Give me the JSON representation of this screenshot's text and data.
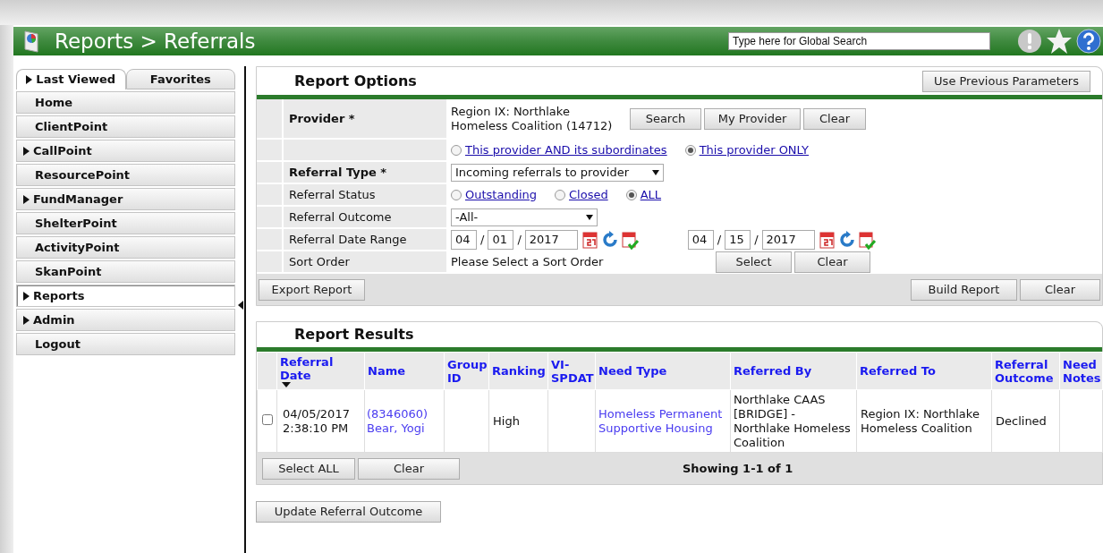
{
  "header": {
    "title": "Reports > Referrals",
    "search_placeholder": "Type here for Global Search"
  },
  "sidebar": {
    "tabs": [
      {
        "label": "Last Viewed",
        "selected": true,
        "expandable": true
      },
      {
        "label": "Favorites",
        "selected": false,
        "expandable": false
      }
    ],
    "items": [
      {
        "label": "Home",
        "expandable": false,
        "selected": false
      },
      {
        "label": "ClientPoint",
        "expandable": false,
        "selected": false
      },
      {
        "label": "CallPoint",
        "expandable": true,
        "selected": false
      },
      {
        "label": "ResourcePoint",
        "expandable": false,
        "selected": false
      },
      {
        "label": "FundManager",
        "expandable": true,
        "selected": false
      },
      {
        "label": "ShelterPoint",
        "expandable": false,
        "selected": false
      },
      {
        "label": "ActivityPoint",
        "expandable": false,
        "selected": false
      },
      {
        "label": "SkanPoint",
        "expandable": false,
        "selected": false
      },
      {
        "label": "Reports",
        "expandable": true,
        "selected": true
      },
      {
        "label": "Admin",
        "expandable": true,
        "selected": false
      },
      {
        "label": "Logout",
        "expandable": false,
        "selected": false
      }
    ]
  },
  "report_options": {
    "title": "Report Options",
    "top_button": "Use Previous Parameters",
    "rows": [
      {
        "kind": "provider",
        "label": "Provider *",
        "bold": true,
        "value": "Region IX: Northlake Homeless Coalition (14712)",
        "buttons": [
          "Search",
          "My Provider",
          "Clear"
        ]
      },
      {
        "kind": "radios",
        "options": [
          {
            "label": "This provider AND its subordinates",
            "selected": false
          },
          {
            "label": "This provider ONLY",
            "selected": true
          }
        ]
      },
      {
        "kind": "select",
        "label": "Referral Type *",
        "bold": true,
        "value": "Incoming referrals to provider"
      },
      {
        "kind": "radios",
        "label": "Referral Status",
        "bold": false,
        "options": [
          {
            "label": "Outstanding",
            "selected": false
          },
          {
            "label": "Closed",
            "selected": false
          },
          {
            "label": "ALL",
            "selected": true
          }
        ]
      },
      {
        "kind": "select",
        "label": "Referral Outcome",
        "bold": false,
        "value": "-All-"
      },
      {
        "kind": "dates",
        "label": "Referral Date Range",
        "bold": false,
        "separator": "/",
        "dates": [
          {
            "month": "04",
            "day": "01",
            "year": "2017"
          },
          {
            "month": "04",
            "day": "15",
            "year": "2017"
          }
        ]
      },
      {
        "kind": "sort",
        "label": "Sort Order",
        "bold": false,
        "value": "Please Select a Sort Order",
        "buttons": [
          "Select",
          "Clear"
        ]
      }
    ],
    "left_buttons": [
      "Export Report"
    ],
    "right_buttons": [
      "Build Report",
      "Clear"
    ]
  },
  "report_results": {
    "title": "Report Results",
    "columns": [
      {
        "label": "Referral Date",
        "sorted": true
      },
      {
        "label": "Name",
        "sorted": false
      },
      {
        "label": "Group ID",
        "sorted": false
      },
      {
        "label": "Ranking",
        "sorted": false
      },
      {
        "label": "VI-SPDAT",
        "sorted": false
      },
      {
        "label": "Need Type",
        "sorted": false
      },
      {
        "label": "Referred By",
        "sorted": false
      },
      {
        "label": "Referred To",
        "sorted": false
      },
      {
        "label": "Referral Outcome",
        "sorted": false
      },
      {
        "label": "Need Notes",
        "sorted": false
      }
    ],
    "rows": [
      {
        "checked": false,
        "date": "04/05/2017",
        "time": "2:38:10 PM",
        "client_id": "(8346060)",
        "name": "Bear, Yogi",
        "ranking": "High",
        "need_type": "Homeless Permanent Supportive Housing",
        "referred_by": "Northlake CAAS [BRIDGE] - Northlake Homeless Coalition",
        "referred_to": "Region IX: Northlake Homeless Coalition",
        "outcome": "Declined"
      }
    ],
    "buttons": [
      "Select ALL",
      "Clear"
    ],
    "showing": "Showing 1-1 of 1"
  },
  "bottom_button": "Update Referral Outcome"
}
